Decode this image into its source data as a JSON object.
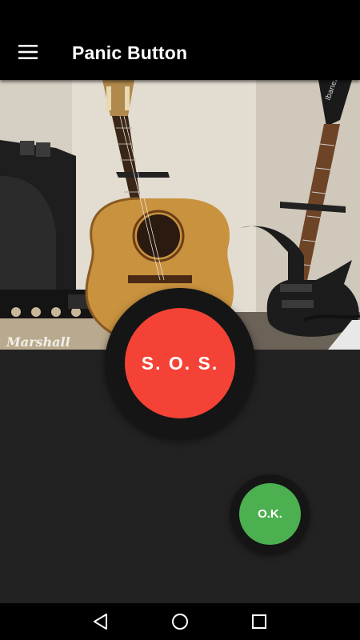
{
  "app_bar": {
    "title": "Panic Button",
    "menu_icon": "hamburger-menu-icon"
  },
  "photo": {
    "description_icon": "guitars-photo",
    "amp_brand": "Marshall"
  },
  "sos_button": {
    "label": "S. O. S.",
    "color": "#f44336"
  },
  "ok_button": {
    "label": "O.K.",
    "color": "#4caf50"
  },
  "nav_bar": {
    "back_icon": "back-triangle-icon",
    "home_icon": "home-circle-icon",
    "recents_icon": "recents-square-icon"
  },
  "colors": {
    "app_bar_bg": "#000000",
    "screen_bg": "#222222",
    "ring_bg": "#151515"
  }
}
